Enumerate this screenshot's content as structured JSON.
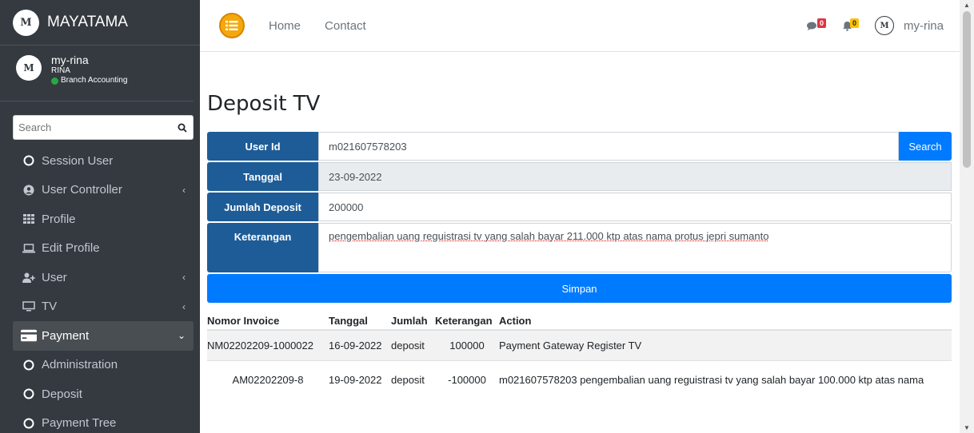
{
  "brand": {
    "logo_text": "M",
    "name": "MAYATAMA"
  },
  "user_panel": {
    "username": "my-rina",
    "name": "RINA",
    "role": "Branch Accounting"
  },
  "sidebar_search": {
    "placeholder": "Search"
  },
  "sidebar": {
    "items": [
      {
        "label": "Session User",
        "icon": "circle-outline-icon",
        "active": false,
        "has_chevron": false
      },
      {
        "label": "User Controller",
        "icon": "user-circle-icon",
        "active": false,
        "has_chevron": true
      },
      {
        "label": "Profile",
        "icon": "grid-icon",
        "active": false,
        "has_chevron": false
      },
      {
        "label": "Edit Profile",
        "icon": "laptop-icon",
        "active": false,
        "has_chevron": false
      },
      {
        "label": "User",
        "icon": "user-plus-icon",
        "active": false,
        "has_chevron": true
      },
      {
        "label": "TV",
        "icon": "tv-icon",
        "active": false,
        "has_chevron": true
      },
      {
        "label": "Payment",
        "icon": "credit-card-icon",
        "active": true,
        "has_chevron": true
      },
      {
        "label": "Administration",
        "icon": "circle-outline-icon",
        "active": false,
        "has_chevron": false
      },
      {
        "label": "Deposit",
        "icon": "circle-outline-icon",
        "active": false,
        "has_chevron": false
      },
      {
        "label": "Payment Tree",
        "icon": "circle-outline-icon",
        "active": false,
        "has_chevron": false
      }
    ]
  },
  "topbar": {
    "links": [
      "Home",
      "Contact"
    ],
    "messages_count": "0",
    "notifications_count": "0",
    "user": "my-rina"
  },
  "page": {
    "title": "Deposit TV"
  },
  "form": {
    "user_id_label": "User Id",
    "user_id_value": "m021607578203",
    "search_button": "Search",
    "tanggal_label": "Tanggal",
    "tanggal_value": "23-09-2022",
    "jumlah_label": "Jumlah Deposit",
    "jumlah_value": "200000",
    "keterangan_label": "Keterangan",
    "keterangan_value": "pengembalian uang reguistrasi tv yang salah bayar 211.000 ktp atas nama protus jepri sumanto",
    "simpan_button": "Simpan"
  },
  "table": {
    "headers": [
      "Nomor Invoice",
      "Tanggal",
      "Jumlah",
      "Keterangan",
      "Action"
    ],
    "rows": [
      [
        "NM02202209-1000022",
        "16-09-2022",
        "deposit",
        "100000",
        "Payment Gateway Register TV"
      ],
      [
        "AM02202209-8",
        "19-09-2022",
        "deposit",
        "-100000",
        "m021607578203 pengembalian uang reguistrasi tv yang salah bayar 100.000 ktp atas nama"
      ]
    ]
  },
  "colors": {
    "sidebar_bg": "#343a40",
    "label_bg": "#1d5c97",
    "primary": "#007bff",
    "toggle": "#f3a90b"
  }
}
